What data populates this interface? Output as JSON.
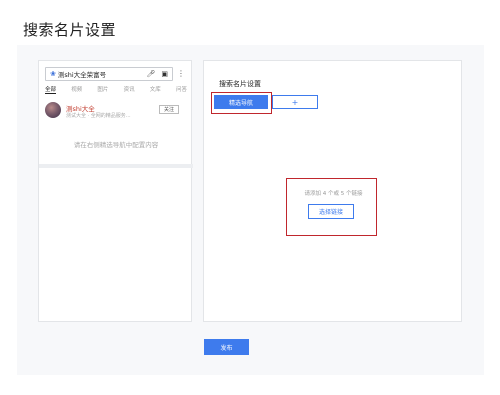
{
  "page": {
    "title": "搜索名片设置"
  },
  "preview": {
    "search_text": "测shi大全荣富号",
    "tabs": [
      {
        "label": "全部",
        "active": true
      },
      {
        "label": "视频"
      },
      {
        "label": "图片"
      },
      {
        "label": "资讯"
      },
      {
        "label": "文库"
      },
      {
        "label": "问答"
      }
    ],
    "card": {
      "name": "测shi大全",
      "subtitle": "测试大全 · 全网的精品服务...",
      "follow_label": "关注"
    },
    "hint": "请在右侧精选导航中配置内容"
  },
  "config": {
    "title": "搜索名片设置",
    "nav_active_label": "精选导航",
    "nav_add_label": "+",
    "link_hint": "请添加 4 个或 5 个链接",
    "choose_link_label": "选择链接"
  },
  "footer": {
    "publish_label": "发布"
  },
  "colors": {
    "accent": "#3e7bed",
    "highlight": "#c0272d",
    "brand_name": "#c0392b"
  }
}
